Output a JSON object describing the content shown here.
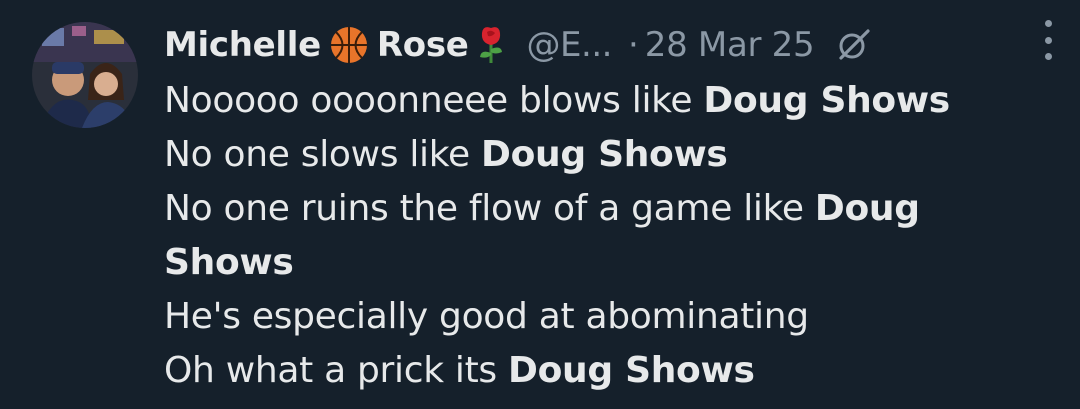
{
  "tweet": {
    "author": {
      "name_first": "Michelle",
      "name_emoji_1": "basketball-emoji",
      "name_last": "Rose",
      "name_emoji_2": "rose-emoji",
      "handle": "@E...",
      "avatar": "avatar-photo"
    },
    "separator": "·",
    "date": "28 Mar 25",
    "icons": {
      "grok": "grok-icon",
      "more": "more-options-icon"
    },
    "lines": [
      {
        "text": "Nooooo oooonneee blows like ",
        "bold": "Doug Shows"
      },
      {
        "text": "No one slows like ",
        "bold": "Doug Shows"
      },
      {
        "text": "No one ruins the flow of a game like ",
        "bold": "Doug Shows"
      },
      {
        "text": "He's especially good at abominating",
        "bold": ""
      },
      {
        "text": "Oh what a prick its ",
        "bold": "Doug Shows"
      }
    ]
  },
  "colors": {
    "background": "#15202b",
    "primary_text": "#e7e9ea",
    "secondary_text": "#8b98a5"
  }
}
